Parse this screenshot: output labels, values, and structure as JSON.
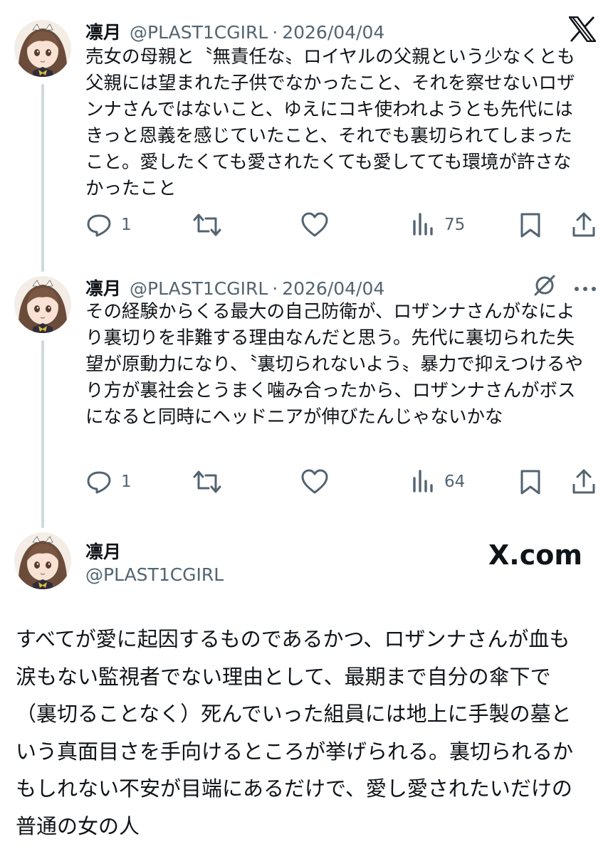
{
  "tweets": [
    {
      "author_name": "凛月",
      "handle": "@PLAST1CGIRL",
      "separator": "·",
      "date": "2026/04/04",
      "text": "売女の母親と〝無責任な〟ロイヤルの父親という少なくとも父親には望まれた子供でなかったこと、それを察せないロザンナさんではないこと、ゆえにコキ使われようとも先代にはきっと恩義を感じていたこと、それでも裏切られてしまったこと。愛したくても愛されたくても愛してても環境が許さなかったこと",
      "replies": "1",
      "views": "75"
    },
    {
      "author_name": "凛月",
      "handle": "@PLAST1CGIRL",
      "separator": "·",
      "date": "2026/04/04",
      "text": "その経験からくる最大の自己防衛が、ロザンナさんがなにより裏切りを非難する理由なんだと思う。先代に裏切られた失望が原動力になり、〝裏切られないよう〟暴力で抑えつけるやり方が裏社会とうまく噛み合ったから、ロザンナさんがボスになると同時にヘッドニアが伸びたんじゃないかな",
      "replies": "1",
      "views": "64"
    }
  ],
  "card": {
    "author_name": "凛月",
    "handle": "@PLAST1CGIRL",
    "site": "X.com",
    "text": "すべてが愛に起因するものであるかつ、ロザンナさんが血も涙もない監視者でない理由として、最期まで自分の傘下で（裏切ることなく）死んでいった組員には地上に手製の墓という真面目さを手向けるところが挙げられる。裏切られるかもしれない不安が目端にあるだけで、愛し愛されたいだけの普通の女の人"
  },
  "icons": {
    "brand": "x-logo-icon",
    "reply": "reply-bubble-icon",
    "retweet": "retweet-icon",
    "like": "heart-icon",
    "views": "views-bars-icon",
    "bookmark": "bookmark-icon",
    "share": "share-upload-icon",
    "grok": "grok-icon",
    "more": "more-dots-icon"
  },
  "colors": {
    "text": "#0f1419",
    "secondary": "#536471",
    "thread_line": "#cfd9de"
  }
}
